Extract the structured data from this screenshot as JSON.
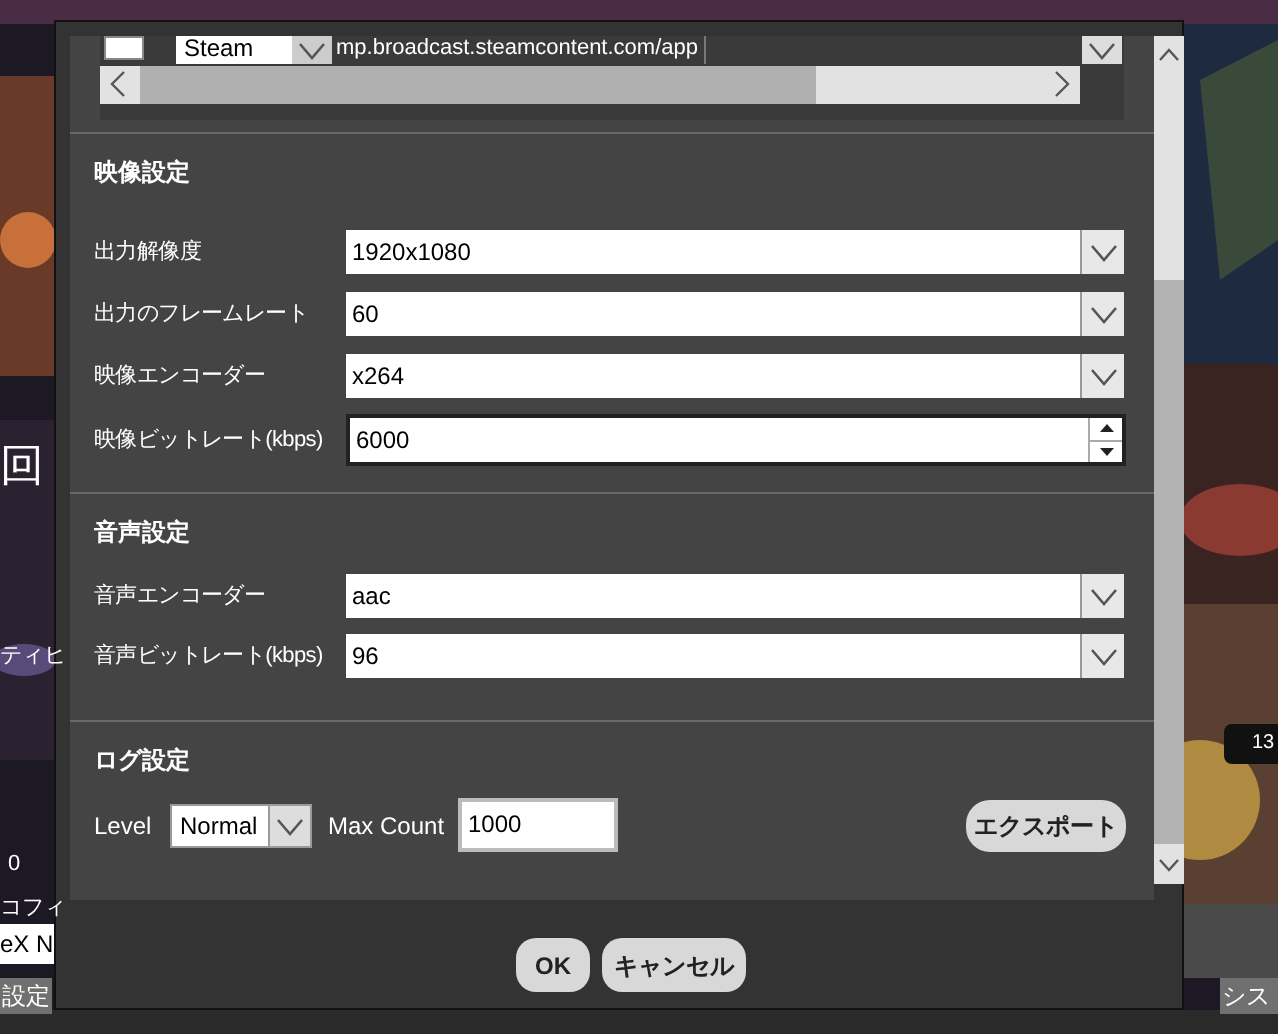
{
  "background": {
    "texts": [
      {
        "text": "回",
        "kind": "large"
      },
      {
        "text": "ティヒ",
        "kind": "small"
      },
      {
        "text": "0",
        "kind": "small"
      },
      {
        "text": "コフィ",
        "kind": "small"
      },
      {
        "text": "eX N",
        "kind": "field"
      },
      {
        "text": "設定",
        "kind": "tab"
      },
      {
        "text": "シス",
        "kind": "tab"
      },
      {
        "text": "13",
        "kind": "badge"
      }
    ]
  },
  "dialog": {
    "stream_row": {
      "checked": false,
      "service": "Steam",
      "url": "mp.broadcast.steamcontent.com/app"
    },
    "sections": [
      {
        "title": "映像設定",
        "rows": [
          {
            "label": "出力解像度",
            "value": "1920x1080",
            "kind": "select"
          },
          {
            "label": "出力のフレームレート",
            "value": "60",
            "kind": "select"
          },
          {
            "label": "映像エンコーダー",
            "value": "x264",
            "kind": "select"
          },
          {
            "label": "映像ビットレート(kbps)",
            "value": "6000",
            "kind": "spin"
          }
        ]
      },
      {
        "title": "音声設定",
        "rows": [
          {
            "label": "音声エンコーダー",
            "value": "aac",
            "kind": "select"
          },
          {
            "label": "音声ビットレート(kbps)",
            "value": "96",
            "kind": "select"
          }
        ]
      },
      {
        "title": "ログ設定",
        "level_label": "Level",
        "level": "Normal",
        "count_label": "Max Count",
        "count": "1000",
        "export": "エクスポート"
      }
    ],
    "buttons": [
      "OK",
      "キャンセル"
    ]
  }
}
